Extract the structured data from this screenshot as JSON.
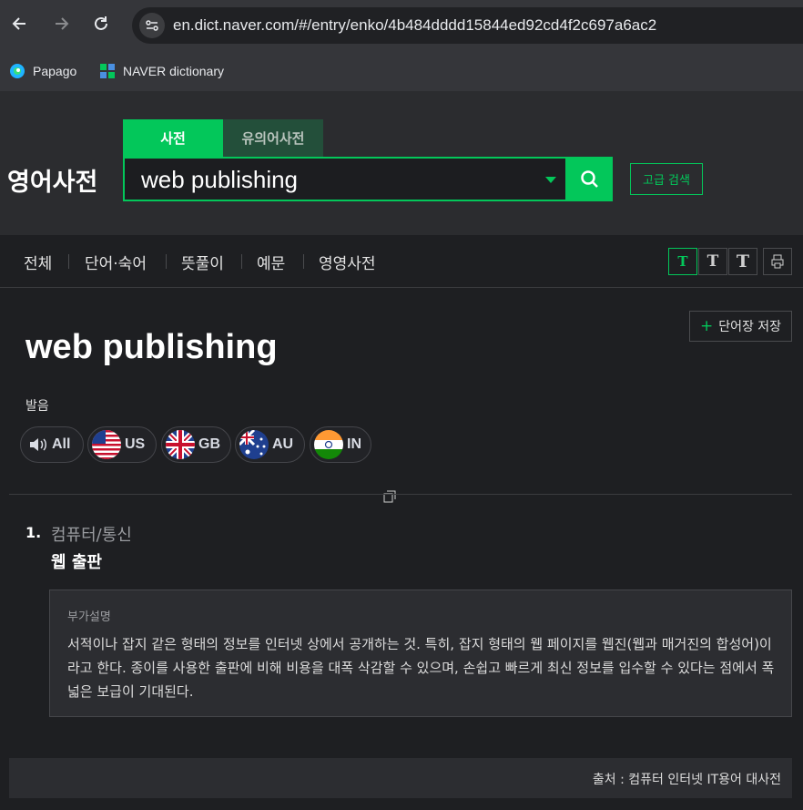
{
  "browser": {
    "url": "en.dict.naver.com/#/entry/enko/4b484dddd15844ed92cd4f2c697a6ac2",
    "bookmarks": [
      {
        "label": "Papago",
        "icon": "papago-icon"
      },
      {
        "label": "NAVER dictionary",
        "icon": "naver-dictionary-icon"
      }
    ]
  },
  "header": {
    "logo": "영어사전",
    "tabs": [
      {
        "label": "사전",
        "active": true
      },
      {
        "label": "유의어사전",
        "active": false
      }
    ],
    "search_value": "web publishing",
    "advanced_search_label": "고급 검색"
  },
  "subnav": {
    "items": [
      "전체",
      "단어·숙어",
      "뜻풀이",
      "예문",
      "영영사전"
    ],
    "font_sizes": [
      "T",
      "T",
      "T"
    ]
  },
  "entry": {
    "save_label": "단어장 저장",
    "headword": "web publishing",
    "pronunciation_label": "발음",
    "pronunciations": [
      "All",
      "US",
      "GB",
      "AU",
      "IN"
    ],
    "meaning": {
      "number": "1.",
      "category": "컴퓨터/통신",
      "text": "웹 출판",
      "extra_title": "부가설명",
      "extra_body": "서적이나 잡지 같은 형태의 정보를 인터넷 상에서 공개하는 것. 특히, 잡지 형태의 웹 페이지를 웹진(웹과 매거진의 합성어)이라고 한다. 종이를 사용한 출판에 비해 비용을 대폭 삭감할 수 있으며, 손쉽고 빠르게 최신 정보를 입수할 수 있다는 점에서 폭넓은 보급이 기대된다."
    },
    "source": "출처 : 컴퓨터 인터넷 IT용어 대사전"
  },
  "colors": {
    "accent": "#03c75a",
    "background": "#1e1f22",
    "header": "#2b2c2f"
  }
}
